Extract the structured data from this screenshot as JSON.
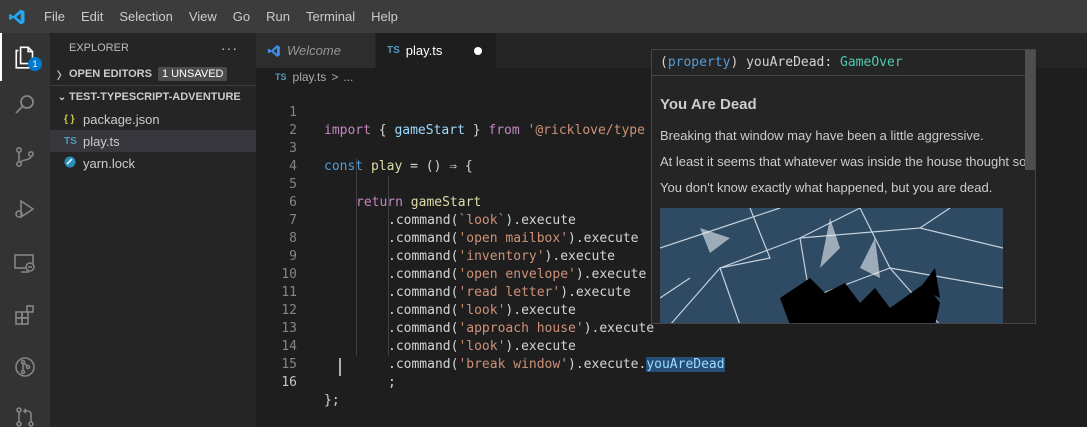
{
  "menu": [
    "File",
    "Edit",
    "Selection",
    "View",
    "Go",
    "Run",
    "Terminal",
    "Help"
  ],
  "activity": {
    "badge": "1",
    "items": [
      "explorer-icon",
      "search-icon",
      "source-control-icon",
      "run-debug-icon",
      "remote-explorer-icon",
      "extensions-icon",
      "git-graph-icon",
      "pull-requests-icon"
    ]
  },
  "sidebar": {
    "title": "EXPLORER",
    "more": "···",
    "open_editors": "OPEN EDITORS",
    "unsaved_badge": "1 UNSAVED",
    "project": "TEST-TYPESCRIPT-ADVENTURE",
    "files": [
      {
        "icon": "{ }",
        "name": "package.json"
      },
      {
        "icon": "TS",
        "name": "play.ts"
      },
      {
        "icon": "yarn-icon",
        "name": "yarn.lock"
      }
    ]
  },
  "tabs": [
    {
      "label": "Welcome"
    },
    {
      "icon": "TS",
      "label": "play.ts"
    }
  ],
  "breadcrumb": {
    "icon": "TS",
    "file": "play.ts",
    "sep": ">",
    "rest": "..."
  },
  "editor": {
    "lines": [
      "1",
      "2",
      "3",
      "4",
      "5",
      "6",
      "7",
      "8",
      "9",
      "10",
      "11",
      "12",
      "13",
      "14",
      "15",
      "16"
    ],
    "code": {
      "l1_import": "import",
      "l1_a": " { ",
      "l1_fn": "gameStart",
      "l1_b": " } ",
      "l1_from": "from",
      "l1_c": " ",
      "l1_str": "'@ricklove/type",
      "l3_const": "const",
      "l3_a": " ",
      "l3_var": "play",
      "l3_b": " = () ⇒ {",
      "l5_return": "return",
      "l5_a": " ",
      "l5_fn": "gameStart",
      "dot_command": ".command(",
      "execute": ").execute",
      "s6": "`look`",
      "s7": "'open mailbox'",
      "s8": "'inventory'",
      "s9": "'open envelope'",
      "s10": "'read letter'",
      "s11": "'look'",
      "s12": "'approach house'",
      "s13": "'look'",
      "s14": "'break window'",
      "l14_dot": ".",
      "l14_prop": "youAreDead",
      "l15": ";",
      "l16": "};"
    }
  },
  "hover": {
    "sig_a": "(",
    "sig_kind": "property",
    "sig_b": ") youAreDead: ",
    "sig_type": "GameOver",
    "title": "You Are Dead",
    "p1": "Breaking that window may have been a little aggressive.",
    "p2": "At least it seems that whatever was inside the house thought so.",
    "p3": "You don't know exactly what happened, but you are dead."
  },
  "colors": {
    "accent": "#007acc",
    "keyword": "#569cd6",
    "control": "#c586c0",
    "function": "#dcdcaa",
    "string": "#ce9178",
    "variable": "#9cdcfe",
    "type": "#4fc1ff"
  }
}
